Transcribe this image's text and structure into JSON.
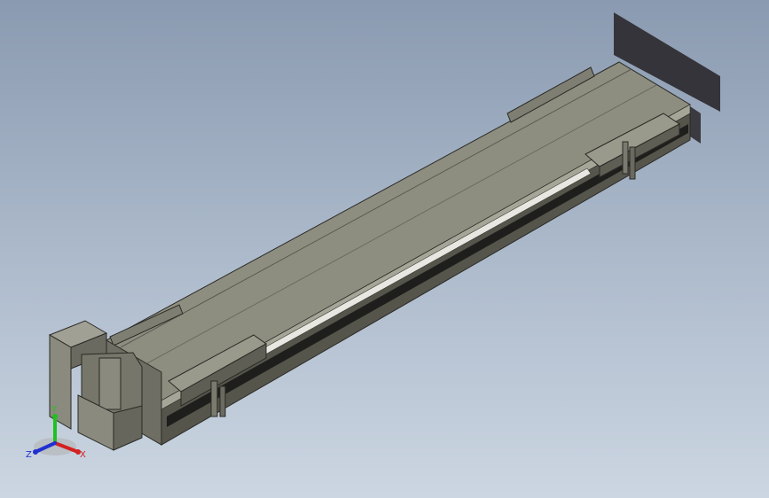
{
  "viewport": {
    "background_top": "#8a9ab0",
    "background_bottom": "#ccd6e2"
  },
  "model": {
    "top_face_color": "#8e8e80",
    "side_face_color": "#5e5e54",
    "edge_color": "#2a2a26",
    "rail_color": "#e8e8e2"
  },
  "triad": {
    "x_label": "X",
    "y_label": "Y",
    "z_label": "Z",
    "x_color": "#d42020",
    "y_color": "#20c020",
    "z_color": "#2030d0"
  }
}
